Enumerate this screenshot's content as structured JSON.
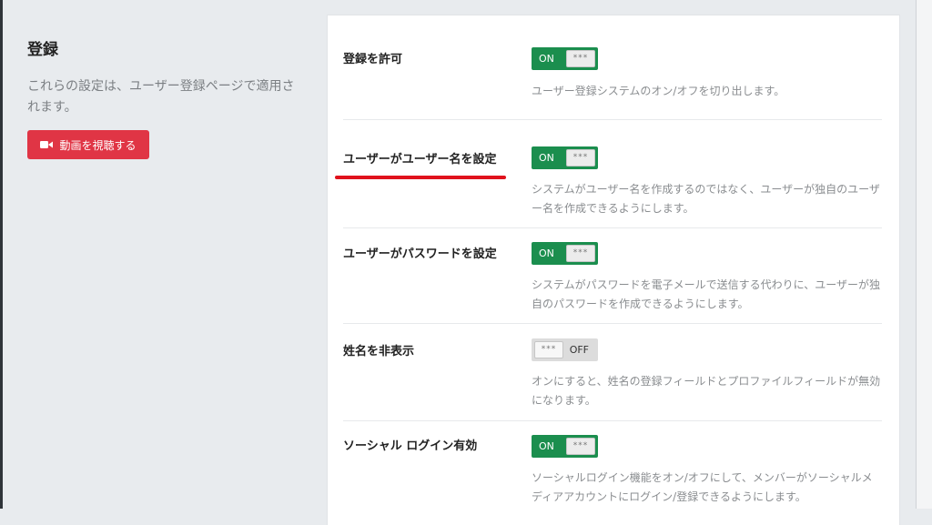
{
  "section": {
    "title": "登録",
    "description": "これらの設定は、ユーザー登録ページで適用されます。",
    "video_button_label": "動画を視聴する"
  },
  "settings": [
    {
      "label": "登録を許可",
      "toggle_state": "ON",
      "knob": "***",
      "description": "ユーザー登録システムのオン/オフを切り出します。"
    },
    {
      "label": "ユーザーがユーザー名を設定",
      "toggle_state": "ON",
      "knob": "***",
      "description": "システムがユーザー名を作成するのではなく、ユーザーが独自のユーザー名を作成できるようにします。"
    },
    {
      "label": "ユーザーがパスワードを設定",
      "toggle_state": "ON",
      "knob": "***",
      "description": "システムがパスワードを電子メールで送信する代わりに、ユーザーが独自のパスワードを作成できるようにします。"
    },
    {
      "label": "姓名を非表示",
      "toggle_state": "OFF",
      "knob": "***",
      "description": "オンにすると、姓名の登録フィールドとプロファイルフィールドが無効になります。"
    },
    {
      "label": "ソーシャル ログイン有効",
      "toggle_state": "ON",
      "knob": "***",
      "description": "ソーシャルログイン機能をオン/オフにして、メンバーがソーシャルメディアアカウントにログイン/登録できるようにします。"
    }
  ],
  "colors": {
    "toggle_on": "#1b8e4e",
    "toggle_off": "#dcdcdc",
    "video_button": "#e03545",
    "highlight": "#e0121c"
  },
  "icons": {
    "video_button_icon": "video-camera-icon"
  }
}
